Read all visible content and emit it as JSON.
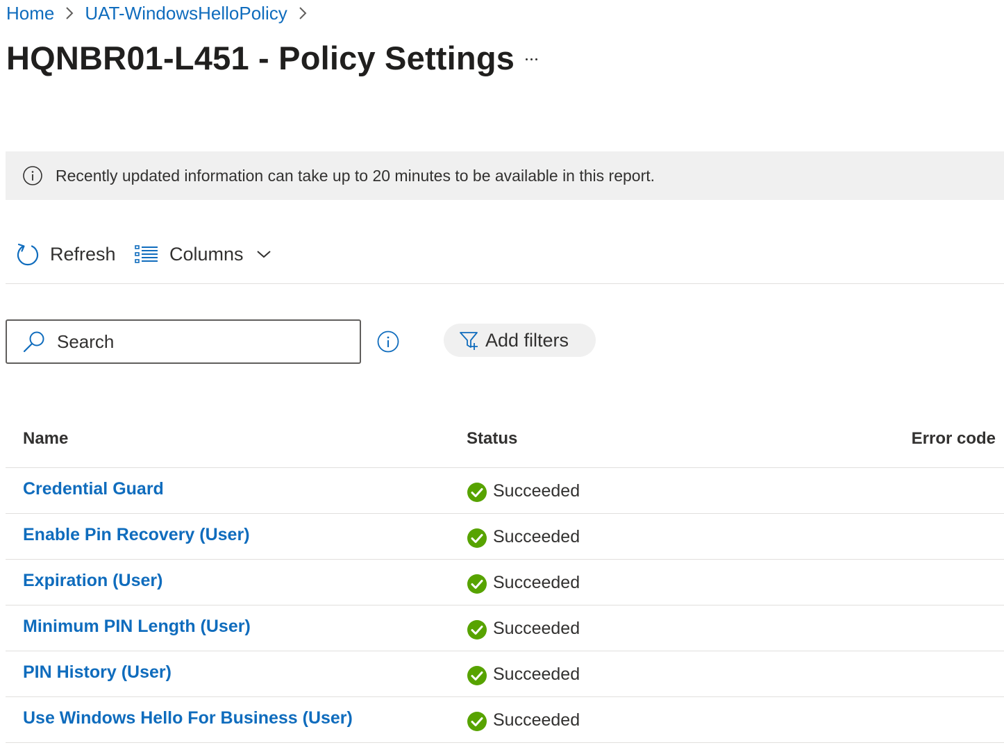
{
  "breadcrumb": {
    "items": [
      "Home",
      "UAT-WindowsHelloPolicy"
    ]
  },
  "page": {
    "title": "HQNBR01-L451 - Policy Settings"
  },
  "banner": {
    "text": "Recently updated information can take up to 20 minutes to be available in this report."
  },
  "toolbar": {
    "refresh_label": "Refresh",
    "columns_label": "Columns"
  },
  "search": {
    "placeholder": "Search",
    "value": ""
  },
  "filters": {
    "add_label": "Add filters"
  },
  "table": {
    "columns": [
      "Name",
      "Status",
      "Error code"
    ],
    "rows": [
      {
        "name": "Credential Guard",
        "status": "Succeeded",
        "error_code": ""
      },
      {
        "name": "Enable Pin Recovery (User)",
        "status": "Succeeded",
        "error_code": ""
      },
      {
        "name": "Expiration (User)",
        "status": "Succeeded",
        "error_code": ""
      },
      {
        "name": "Minimum PIN Length (User)",
        "status": "Succeeded",
        "error_code": ""
      },
      {
        "name": "PIN History (User)",
        "status": "Succeeded",
        "error_code": ""
      },
      {
        "name": "Use Windows Hello For Business (User)",
        "status": "Succeeded",
        "error_code": ""
      }
    ]
  },
  "icons": {
    "chevron": "chevron-right-icon",
    "more": "more-icon",
    "info": "info-icon",
    "refresh": "refresh-icon",
    "columns": "columns-list-icon",
    "search": "search-icon",
    "filter": "filter-add-icon",
    "status": "success-check-icon"
  },
  "colors": {
    "link": "#0f6cbd",
    "success": "#57a300",
    "banner_bg": "#f0f0f0"
  }
}
